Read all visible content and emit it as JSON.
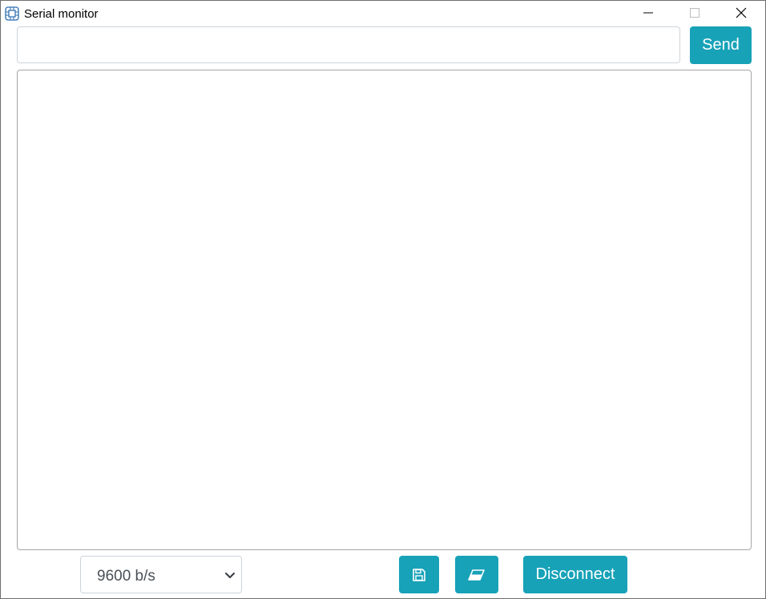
{
  "window": {
    "title": "Serial monitor",
    "icons": {
      "app": "circuit-board-icon",
      "minimize": "minimize-icon",
      "maximize": "maximize-icon",
      "close": "close-icon"
    }
  },
  "send": {
    "input_value": "",
    "placeholder": "",
    "button_label": "Send"
  },
  "output": {
    "text": ""
  },
  "footer": {
    "baud_rate": "9600 b/s",
    "save_icon": "save-icon",
    "clear_icon": "eraser-icon",
    "disconnect_label": "Disconnect"
  },
  "colors": {
    "accent": "#17a2b8",
    "border": "#ced4da",
    "text_muted": "#495057"
  }
}
